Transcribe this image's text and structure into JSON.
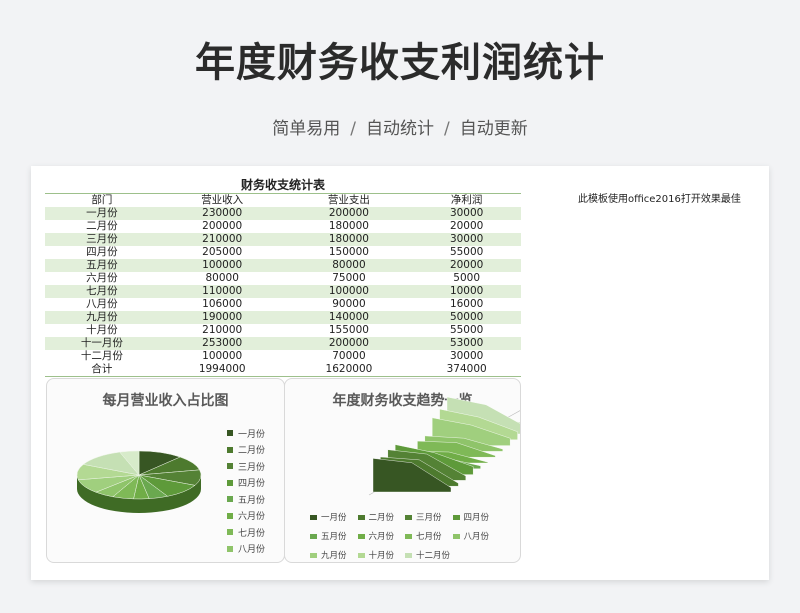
{
  "header": {
    "title": "年度财务收支利润统计",
    "subtitle_parts": [
      "简单易用",
      "自动统计",
      "自动更新"
    ],
    "separator": "/"
  },
  "sheet": {
    "note": "此模板使用office2016打开效果最佳",
    "table_title": "财务收支统计表",
    "columns": [
      "部门",
      "营业收入",
      "营业支出",
      "净利润"
    ],
    "rows": [
      [
        "一月份",
        "230000",
        "200000",
        "30000"
      ],
      [
        "二月份",
        "200000",
        "180000",
        "20000"
      ],
      [
        "三月份",
        "210000",
        "180000",
        "30000"
      ],
      [
        "四月份",
        "205000",
        "150000",
        "55000"
      ],
      [
        "五月份",
        "100000",
        "80000",
        "20000"
      ],
      [
        "六月份",
        "80000",
        "75000",
        "5000"
      ],
      [
        "七月份",
        "110000",
        "100000",
        "10000"
      ],
      [
        "八月份",
        "106000",
        "90000",
        "16000"
      ],
      [
        "九月份",
        "190000",
        "140000",
        "50000"
      ],
      [
        "十月份",
        "210000",
        "155000",
        "55000"
      ],
      [
        "十一月份",
        "253000",
        "200000",
        "53000"
      ],
      [
        "十二月份",
        "100000",
        "70000",
        "30000"
      ]
    ],
    "total": [
      "合计",
      "1994000",
      "1620000",
      "374000"
    ]
  },
  "colors": {
    "row_band": "#e2efda",
    "greens": [
      "#375623",
      "#4d7a2e",
      "#548235",
      "#5e9a3a",
      "#6aa84f",
      "#70ad47",
      "#7fb957",
      "#8fc46a",
      "#a0cf7e",
      "#b3d993",
      "#c5e0b4",
      "#d7ebca"
    ]
  },
  "chart_data": [
    {
      "type": "pie",
      "title": "每月营业收入占比图",
      "categories": [
        "一月份",
        "二月份",
        "三月份",
        "四月份",
        "五月份",
        "六月份",
        "七月份",
        "八月份",
        "九月份",
        "十月份",
        "十一月份",
        "十二月份"
      ],
      "values": [
        230000,
        200000,
        210000,
        205000,
        100000,
        80000,
        110000,
        106000,
        190000,
        210000,
        253000,
        100000
      ],
      "legend_visible": [
        "一月份",
        "二月份",
        "三月份",
        "四月份",
        "五月份",
        "六月份",
        "七月份",
        "八月份"
      ],
      "legend_position": "right"
    },
    {
      "type": "area",
      "title": "年度财务收支趋势一览",
      "categories": [
        "营业收入",
        "营业支出",
        "净利润"
      ],
      "series": [
        {
          "name": "一月份",
          "values": [
            230000,
            200000,
            30000
          ]
        },
        {
          "name": "二月份",
          "values": [
            200000,
            180000,
            20000
          ]
        },
        {
          "name": "三月份",
          "values": [
            210000,
            180000,
            30000
          ]
        },
        {
          "name": "四月份",
          "values": [
            205000,
            150000,
            55000
          ]
        },
        {
          "name": "五月份",
          "values": [
            100000,
            80000,
            20000
          ]
        },
        {
          "name": "六月份",
          "values": [
            80000,
            75000,
            5000
          ]
        },
        {
          "name": "七月份",
          "values": [
            110000,
            100000,
            10000
          ]
        },
        {
          "name": "八月份",
          "values": [
            106000,
            90000,
            16000
          ]
        },
        {
          "name": "九月份",
          "values": [
            190000,
            140000,
            50000
          ]
        },
        {
          "name": "十月份",
          "values": [
            210000,
            155000,
            55000
          ]
        },
        {
          "name": "十一月份",
          "values": [
            253000,
            200000,
            53000
          ]
        },
        {
          "name": "十二月份",
          "values": [
            100000,
            70000,
            30000
          ]
        }
      ],
      "legend_visible": [
        "一月份",
        "二月份",
        "三月份",
        "四月份",
        "五月份",
        "六月份",
        "七月份",
        "八月份",
        "九月份",
        "十月份",
        "十二月份"
      ],
      "legend_position": "bottom"
    }
  ]
}
